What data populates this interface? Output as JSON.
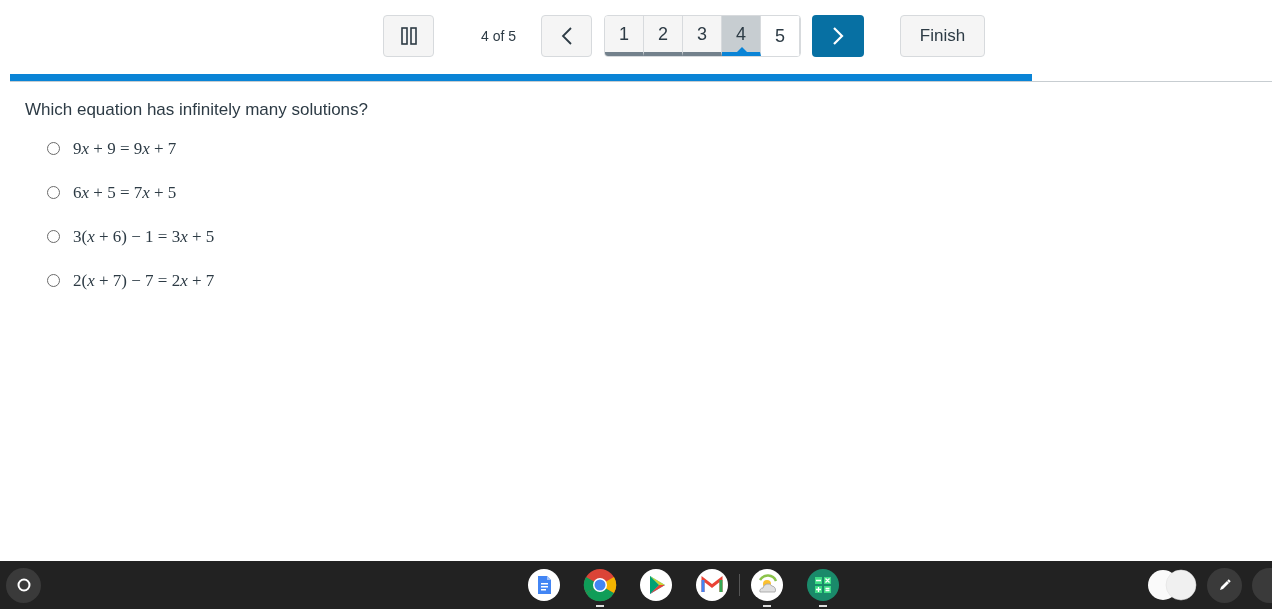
{
  "toolbar": {
    "position": "4 of 5",
    "pages": [
      {
        "label": "1",
        "answered": true,
        "selected": false
      },
      {
        "label": "2",
        "answered": true,
        "selected": false
      },
      {
        "label": "3",
        "answered": true,
        "selected": false
      },
      {
        "label": "4",
        "answered": false,
        "selected": true
      },
      {
        "label": "5",
        "answered": false,
        "selected": false
      }
    ],
    "finish": "Finish"
  },
  "progress": {
    "level": 0.81
  },
  "question": {
    "prompt": "Which equation has infinitely many solutions?",
    "options": [
      {
        "segments": [
          {
            "text": "9",
            "italic": false
          },
          {
            "text": "x",
            "italic": true
          },
          {
            "text": " + 9 = 9",
            "italic": false
          },
          {
            "text": "x",
            "italic": true
          },
          {
            "text": " + 7",
            "italic": false
          }
        ],
        "selected": false
      },
      {
        "segments": [
          {
            "text": "6",
            "italic": false
          },
          {
            "text": "x",
            "italic": true
          },
          {
            "text": " + 5 = 7",
            "italic": false
          },
          {
            "text": "x",
            "italic": true
          },
          {
            "text": " + 5",
            "italic": false
          }
        ],
        "selected": false
      },
      {
        "segments": [
          {
            "text": "3(",
            "italic": false
          },
          {
            "text": "x",
            "italic": true
          },
          {
            "text": " + 6) − 1 = 3",
            "italic": false
          },
          {
            "text": "x",
            "italic": true
          },
          {
            "text": " + 5",
            "italic": false
          }
        ],
        "selected": false
      },
      {
        "segments": [
          {
            "text": "2(",
            "italic": false
          },
          {
            "text": "x",
            "italic": true
          },
          {
            "text": " + 7) − 7 = 2",
            "italic": false
          },
          {
            "text": "x",
            "italic": true
          },
          {
            "text": " + 7",
            "italic": false
          }
        ],
        "selected": false
      }
    ]
  },
  "shelf": {
    "apps": [
      {
        "kind": "docs",
        "running": false
      },
      {
        "kind": "chrome",
        "running": true
      },
      {
        "kind": "play",
        "running": false
      },
      {
        "kind": "gmail",
        "running": false
      },
      {
        "kind": "weather",
        "running": true
      },
      {
        "kind": "calculator",
        "running": true
      }
    ]
  }
}
